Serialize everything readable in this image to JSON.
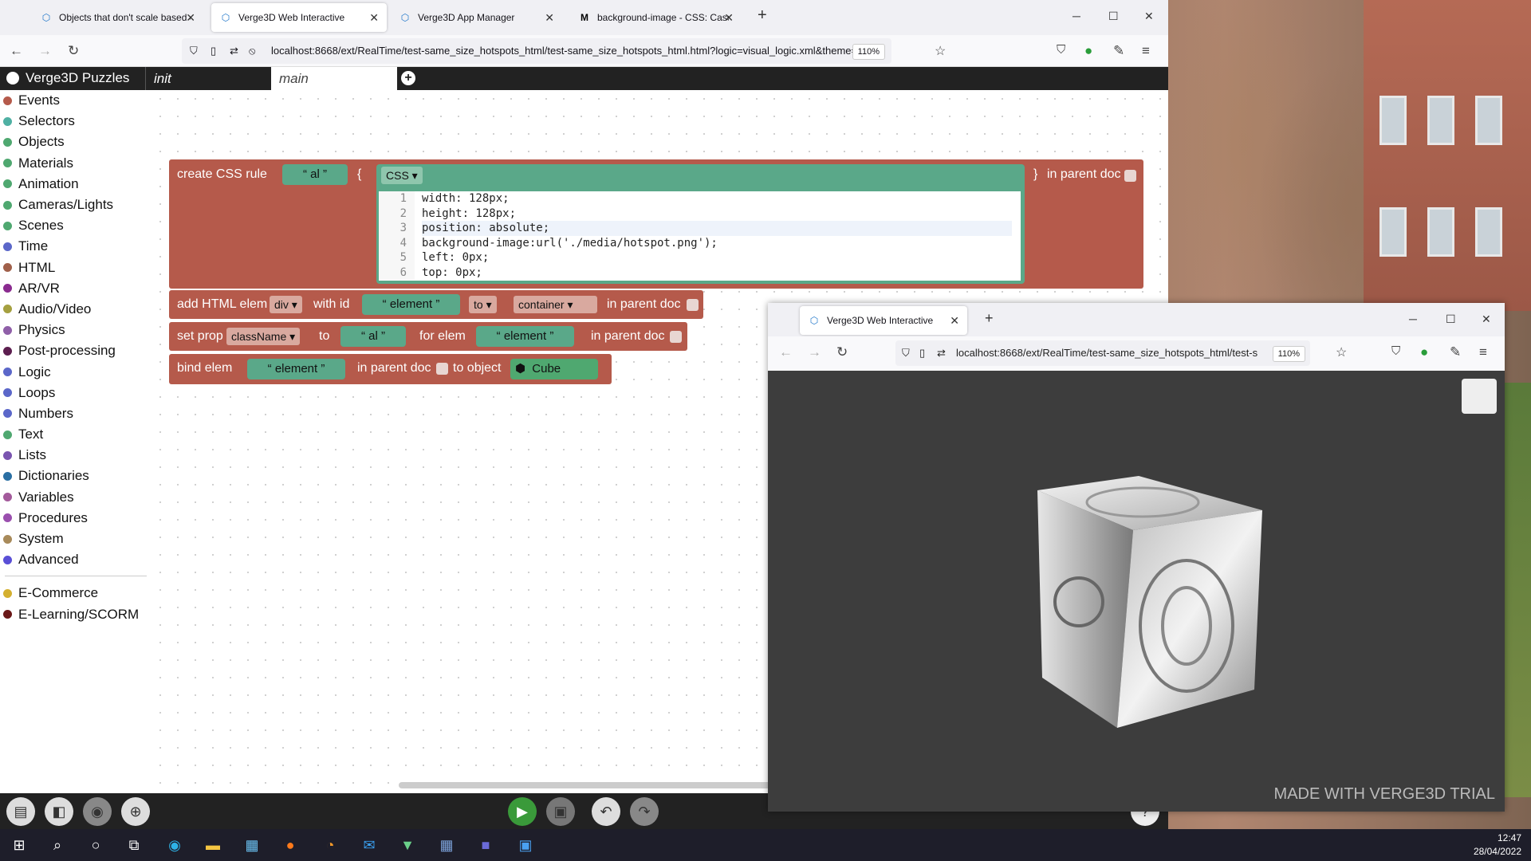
{
  "browser_main": {
    "tabs": [
      {
        "label": "Objects that don't scale based o"
      },
      {
        "label": "Verge3D Web Interactive"
      },
      {
        "label": "Verge3D App Manager"
      },
      {
        "label": "background-image - CSS: Casc"
      }
    ],
    "url": "localhost:8668/ext/RealTime/test-same_size_hotspots_html/test-same_size_hotspots_html.html?logic=visual_logic.xml&theme=",
    "zoom": "110%"
  },
  "puzzles": {
    "title": "Verge3D Puzzles",
    "tabs": [
      "init",
      "main"
    ],
    "categories": [
      {
        "label": "Events",
        "color": "#b55a4b"
      },
      {
        "label": "Selectors",
        "color": "#4fb0a3"
      },
      {
        "label": "Objects",
        "color": "#4fa870"
      },
      {
        "label": "Materials",
        "color": "#4fa870"
      },
      {
        "label": "Animation",
        "color": "#4fa870"
      },
      {
        "label": "Cameras/Lights",
        "color": "#4fa870"
      },
      {
        "label": "Scenes",
        "color": "#4fa870"
      },
      {
        "label": "Time",
        "color": "#5b67c9"
      },
      {
        "label": "HTML",
        "color": "#a0604a"
      },
      {
        "label": "AR/VR",
        "color": "#8a2b8f"
      },
      {
        "label": "Audio/Video",
        "color": "#a5a040"
      },
      {
        "label": "Physics",
        "color": "#8f5fa8"
      },
      {
        "label": "Post-processing",
        "color": "#5c1e4f"
      },
      {
        "label": "Logic",
        "color": "#5b67c9"
      },
      {
        "label": "Loops",
        "color": "#5b67c9"
      },
      {
        "label": "Numbers",
        "color": "#5b67c9"
      },
      {
        "label": "Text",
        "color": "#4fa870"
      },
      {
        "label": "Lists",
        "color": "#7a55b0"
      },
      {
        "label": "Dictionaries",
        "color": "#2a6fa3"
      },
      {
        "label": "Variables",
        "color": "#a35a9b"
      },
      {
        "label": "Procedures",
        "color": "#9a4fae"
      },
      {
        "label": "System",
        "color": "#a88a5a"
      },
      {
        "label": "Advanced",
        "color": "#5a4fd6"
      }
    ],
    "extra_categories": [
      {
        "label": "E-Commerce",
        "color": "#d4b030"
      },
      {
        "label": "E-Learning/SCORM",
        "color": "#6a1818"
      }
    ],
    "blocks": {
      "css_rule": {
        "label": "create CSS rule",
        "name": "al",
        "brace_open": "{",
        "lang": "CSS",
        "brace_close": "}",
        "in_parent": "in parent doc"
      },
      "code_lines": [
        {
          "n": "1",
          "text": "width: 128px;"
        },
        {
          "n": "2",
          "text": "height: 128px;"
        },
        {
          "n": "3",
          "text": "position: absolute;"
        },
        {
          "n": "4",
          "text": "background-image:url('./media/hotspot.png');"
        },
        {
          "n": "5",
          "text": "left: 0px;"
        },
        {
          "n": "6",
          "text": "top: 0px;"
        }
      ],
      "add_html": {
        "label": "add HTML elem",
        "tag": "div",
        "with_id": "with id",
        "id": "element",
        "to": "to",
        "target": "container",
        "in_parent": "in parent doc"
      },
      "set_prop": {
        "label": "set prop",
        "prop": "className",
        "to": "to",
        "value": "al",
        "for_elem": "for elem",
        "elem": "element",
        "in_parent": "in parent doc"
      },
      "bind_elem": {
        "label": "bind elem",
        "elem": "element",
        "in_parent": "in parent doc",
        "to_object": "to object",
        "object": "Cube"
      }
    }
  },
  "browser_second": {
    "tab": "Verge3D Web Interactive",
    "url": "localhost:8668/ext/RealTime/test-same_size_hotspots_html/test-s",
    "zoom": "110%",
    "watermark": "MADE WITH VERGE3D TRIAL"
  },
  "taskbar": {
    "time": "12:47",
    "date": "28/04/2022"
  }
}
